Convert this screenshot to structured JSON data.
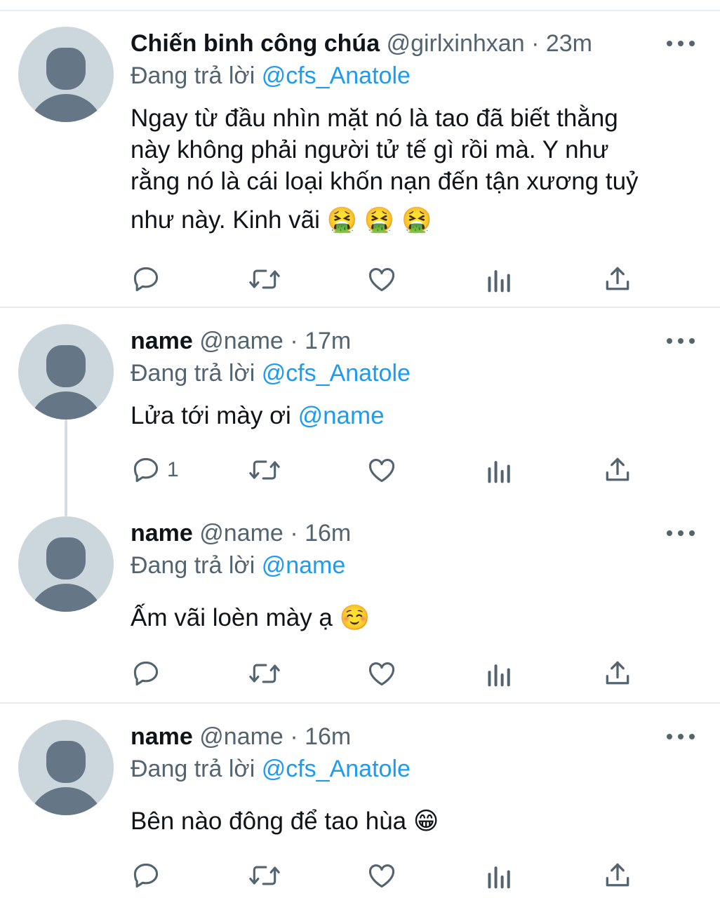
{
  "tweets": [
    {
      "name": "Chiến binh công chúa",
      "handle": "@girlxinhxan",
      "time": "23m",
      "reply_prefix": "Đang trả lời",
      "reply_to": "@cfs_Anatole",
      "text_lines": [
        "Ngay từ đầu nhìn mặt nó là tao đã biết thằng",
        "này không phải người tử tế gì rồi mà. Y như",
        "rằng nó là cái loại khốn nạn đến tận xương tuỷ",
        "như này. Kinh vãi 🤮 🤮 🤮"
      ],
      "reply_count": ""
    },
    {
      "name": "name",
      "handle": "@name",
      "time": "17m",
      "reply_prefix": "Đang trả lời",
      "reply_to": "@cfs_Anatole",
      "text": "Lửa tới mày ơi ",
      "text_mention": "@name",
      "reply_count": "1"
    },
    {
      "name": "name",
      "handle": "@name",
      "time": "16m",
      "reply_prefix": "Đang trả lời",
      "reply_to": "@name",
      "text": "Ấm vãi loèn mày ạ ☺️",
      "reply_count": ""
    },
    {
      "name": "name",
      "handle": "@name",
      "time": "16m",
      "reply_prefix": "Đang trả lời",
      "reply_to": "@cfs_Anatole",
      "text": "Bên nào đông để tao hùa 😁",
      "reply_count": ""
    }
  ],
  "separator": "·",
  "icons": [
    "reply-icon",
    "retweet-icon",
    "like-icon",
    "analytics-icon",
    "share-icon",
    "more-icon"
  ],
  "colors": {
    "mention": "#1d9bf0",
    "meta": "#536471",
    "avatar_bg": "#ccd6dd",
    "avatar_fg": "#657786"
  }
}
